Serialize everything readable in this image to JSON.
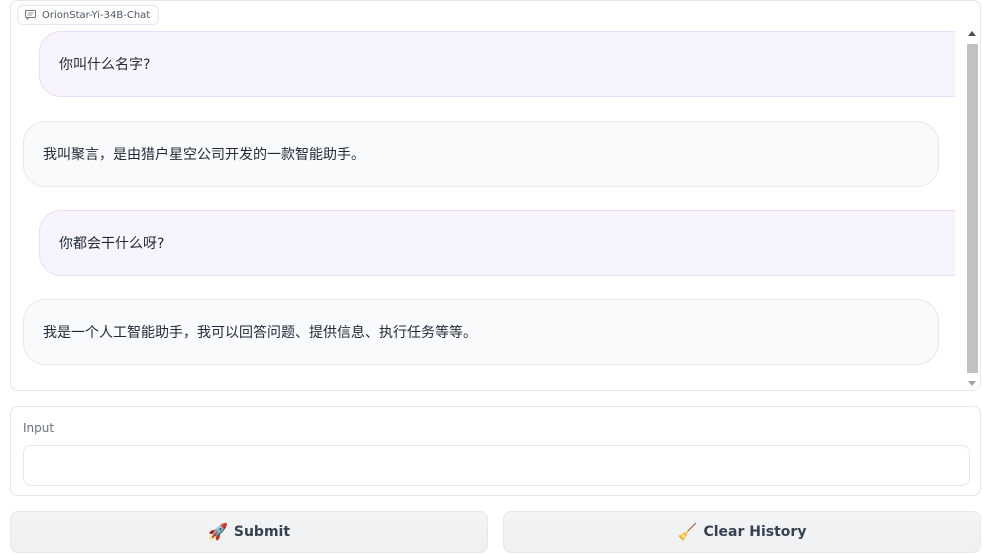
{
  "chatbot": {
    "label": "OrionStar-Yi-34B-Chat",
    "messages": [
      {
        "role": "user",
        "text": "你叫什么名字?"
      },
      {
        "role": "bot",
        "text": "我叫聚言，是由猎户星空公司开发的一款智能助手。"
      },
      {
        "role": "user",
        "text": "你都会干什么呀?"
      },
      {
        "role": "bot",
        "text": "我是一个人工智能助手，我可以回答问题、提供信息、执行任务等等。"
      }
    ]
  },
  "input": {
    "label": "Input",
    "value": "",
    "placeholder": ""
  },
  "buttons": {
    "submit_icon": "🚀",
    "submit_label": "Submit",
    "clear_icon": "🧹",
    "clear_label": "Clear History"
  },
  "colors": {
    "user_bubble": "#f8f4fe",
    "bot_bubble": "#f9fafb",
    "border": "#e5e7eb"
  }
}
